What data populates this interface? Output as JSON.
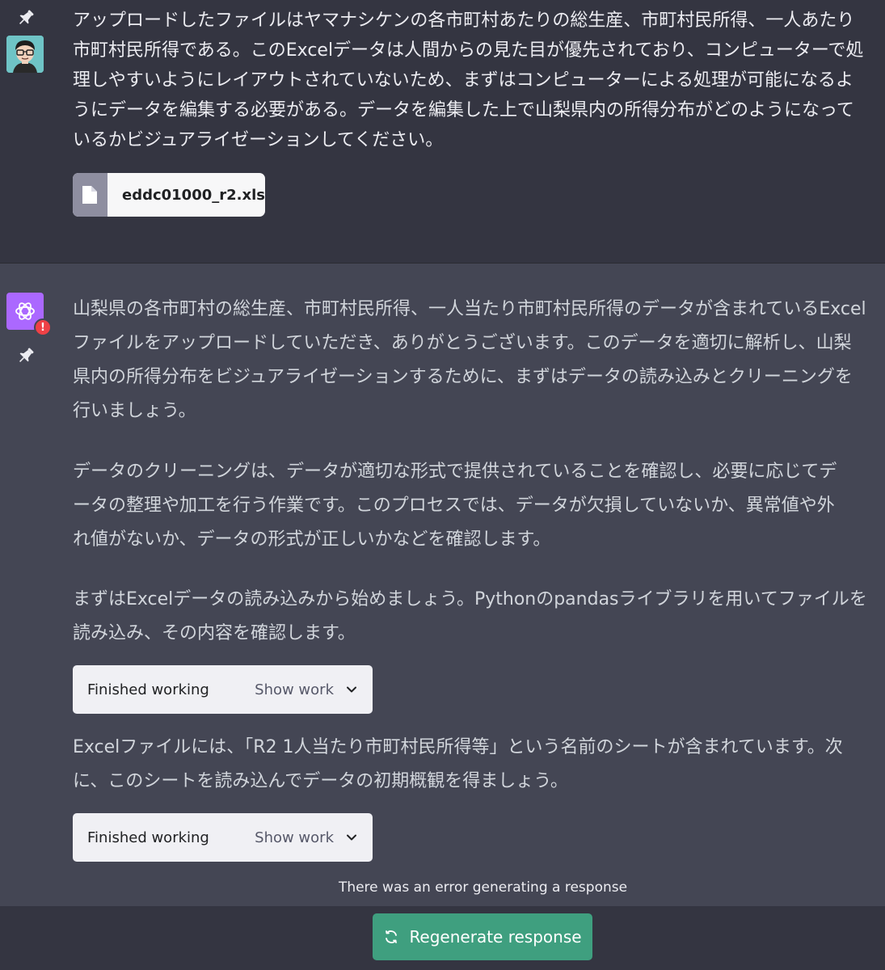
{
  "user_message": {
    "text": "アップロードしたファイルはヤマナシケンの各市町村あたりの総生産、市町村民所得、一人あたり市町村民所得である。このExcelデータは人間からの見た目が優先されており、コンピューターで処理しやすいようにレイアウトされていないため、まずはコンピューターによる処理が可能になるようにデータを編集する必要がある。データを編集した上で山梨県内の所得分布がどのようになっているかビジュアライゼーションしてください。",
    "attachment": {
      "filename": "eddc01000_r2.xls",
      "icon": "file-icon"
    },
    "avatar_icon": "user-avatar",
    "pin_icon": "pin-icon"
  },
  "assistant_message": {
    "avatar_icon": "openai-logo-icon",
    "error_badge": "!",
    "pin_icon": "pin-icon",
    "paragraphs": [
      "山梨県の各市町村の総生産、市町村民所得、一人当たり市町村民所得のデータが含まれているExcelファイルをアップロードしていただき、ありがとうございます。このデータを適切に解析し、山梨県内の所得分布をビジュアライゼーションするために、まずはデータの読み込みとクリーニングを行いましょう。",
      "データのクリーニングは、データが適切な形式で提供されていることを確認し、必要に応じてデータの整理や加工を行う作業です。このプロセスでは、データが欠損していないか、異常値や外れ値がないか、データの形式が正しいかなどを確認します。",
      "まずはExcelデータの読み込みから始めましょう。Pythonのpandasライブラリを用いてファイルを読み込み、その内容を確認します。",
      "Excelファイルには、「R2 1人当たり市町村民所得等」という名前のシートが含まれています。次に、このシートを読み込んでデータの初期概観を得ましょう。"
    ],
    "work_blocks": [
      {
        "status": "Finished working",
        "toggle": "Show work",
        "icon": "chevron-down-icon"
      },
      {
        "status": "Finished working",
        "toggle": "Show work",
        "icon": "chevron-down-icon"
      }
    ]
  },
  "error_message": "There was an error generating a response",
  "regenerate": {
    "label": "Regenerate response",
    "icon": "refresh-icon"
  },
  "colors": {
    "user_bg": "#343541",
    "assistant_bg": "#444654",
    "accent": "#3f9f7f",
    "gpt_avatar": "#ab68ff",
    "error": "#ef4146"
  }
}
